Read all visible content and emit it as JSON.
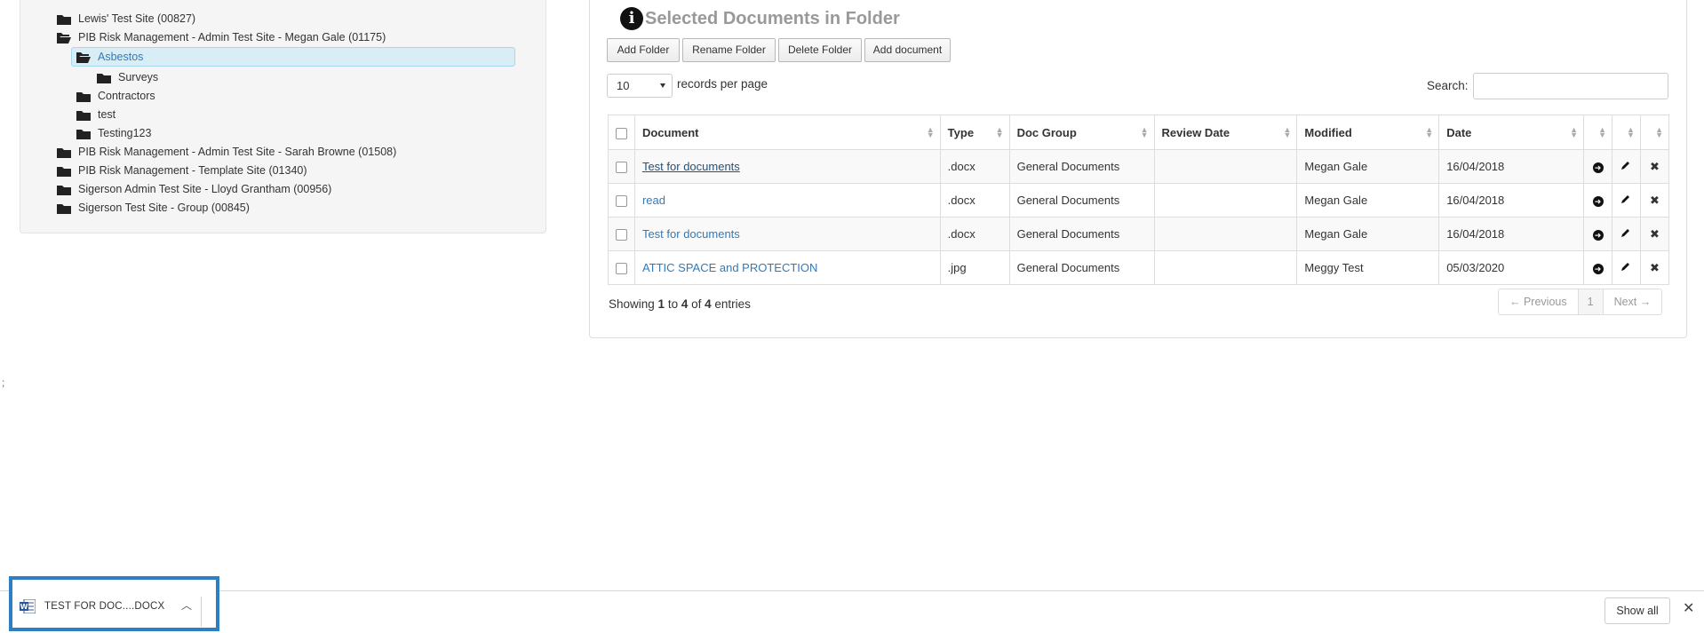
{
  "tree": {
    "items": [
      {
        "label": "Lewis' Test Site (00827)",
        "open": false
      },
      {
        "label": "PIB Risk Management - Admin Test Site - Megan Gale (01175)",
        "open": true
      },
      {
        "label": "Asbestos",
        "open": true,
        "selected": true
      },
      {
        "label": "Surveys",
        "open": false
      },
      {
        "label": "Contractors",
        "open": false
      },
      {
        "label": "test",
        "open": false
      },
      {
        "label": "Testing123",
        "open": false
      },
      {
        "label": "PIB Risk Management - Admin Test Site - Sarah Browne (01508)",
        "open": false
      },
      {
        "label": "PIB Risk Management - Template Site (01340)",
        "open": false
      },
      {
        "label": "Sigerson Admin Test Site - Lloyd Grantham (00956)",
        "open": false
      },
      {
        "label": "Sigerson Test Site - Group (00845)",
        "open": false
      }
    ]
  },
  "docs": {
    "title": "Selected Documents in Folder",
    "buttons": {
      "add_folder": "Add Folder",
      "rename_folder": "Rename Folder",
      "delete_folder": "Delete Folder",
      "add_document": "Add document"
    },
    "length_value": "10",
    "length_label": "records per page",
    "search_label": "Search:",
    "search_value": "",
    "columns": [
      "Document",
      "Type",
      "Doc Group",
      "Review Date",
      "Modified",
      "Date"
    ],
    "rows": [
      {
        "document": "Test for documents",
        "type": ".docx",
        "group": "General Documents",
        "review": "",
        "modified": "Megan Gale",
        "date": "16/04/2018"
      },
      {
        "document": "read",
        "type": ".docx",
        "group": "General Documents",
        "review": "",
        "modified": "Megan Gale",
        "date": "16/04/2018"
      },
      {
        "document": "Test for documents",
        "type": ".docx",
        "group": "General Documents",
        "review": "",
        "modified": "Megan Gale",
        "date": "16/04/2018"
      },
      {
        "document": "ATTIC SPACE and PROTECTION",
        "type": ".jpg",
        "group": "General Documents",
        "review": "",
        "modified": "Meggy Test",
        "date": "05/03/2020"
      }
    ],
    "info": {
      "prefix": "Showing ",
      "from": "1",
      "to_word": " to ",
      "to": "4",
      "of_word": " of ",
      "total": "4",
      "suffix": " entries"
    },
    "pager": {
      "previous": "← Previous",
      "page": "1",
      "next": "Next →"
    }
  },
  "stray_text": ";",
  "downloads": {
    "file_name": "TEST FOR DOC....DOCX",
    "show_all": "Show all",
    "accent": "#2d7fc1"
  },
  "icons": {
    "folder": "folder-icon",
    "folder_open": "folder-open-icon",
    "info": "info-icon",
    "view": "circle-arrow-right-icon",
    "edit": "pencil-icon",
    "delete": "close-icon"
  }
}
